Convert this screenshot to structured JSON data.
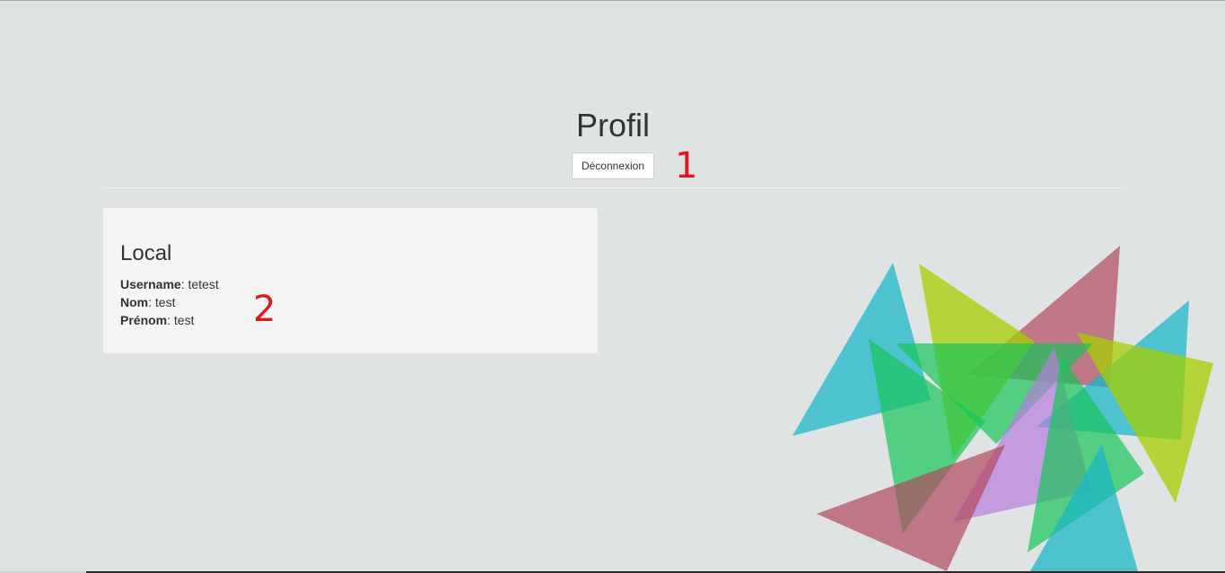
{
  "page": {
    "title": "Profil",
    "logout_label": "Déconnexion"
  },
  "annotations": {
    "first": "1",
    "second": "2"
  },
  "local_card": {
    "title": "Local",
    "separator": ": ",
    "fields": [
      {
        "label": "Username",
        "value": "tetest"
      },
      {
        "label": "Nom",
        "value": "test"
      },
      {
        "label": "Prénom",
        "value": "test"
      }
    ]
  },
  "colors": {
    "background": "#dfe3e3",
    "annotation": "#e3161f",
    "triangle_cyan": "#16b7c7",
    "triangle_lime": "#a6cf00",
    "triangle_rose": "#b0485e",
    "triangle_green": "#18c45a",
    "triangle_violet": "#b57ddd"
  },
  "decoration": {
    "name": "triangles-illustration"
  }
}
